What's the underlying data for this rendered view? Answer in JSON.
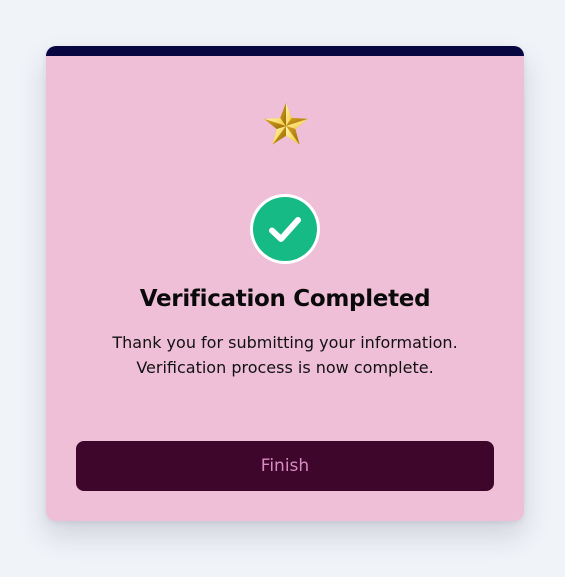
{
  "dialog": {
    "star_icon": "star-icon",
    "check_icon": "check-circle-icon",
    "title": "Verification Completed",
    "message_line_1": "Thank you for submitting your information.",
    "message_line_2": "Verification process is now complete.",
    "finish_label": "Finish"
  },
  "colors": {
    "page_background": "#f0f3f8",
    "card_background": "#efbfd8",
    "top_bar": "#070640",
    "check_green": "#16ba84",
    "button_background": "#3d062a",
    "button_text": "#d98ac3"
  }
}
